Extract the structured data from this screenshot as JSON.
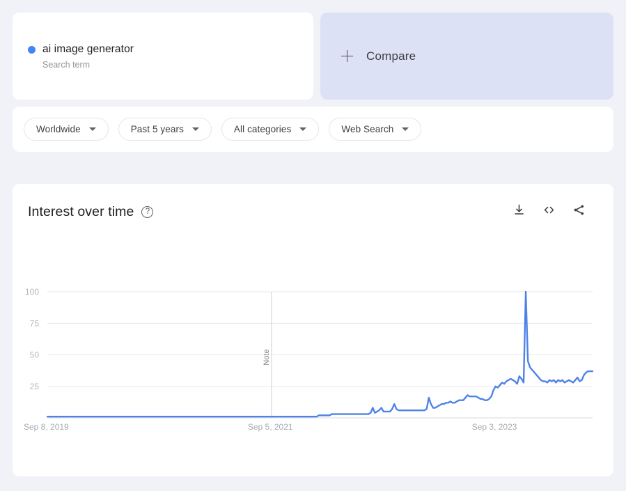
{
  "search_term_card": {
    "term": "ai image generator",
    "subtitle": "Search term",
    "dot_color": "#4285f4"
  },
  "compare_card": {
    "label": "Compare",
    "icon": "plus-icon",
    "background": "#dce1f6"
  },
  "filters": [
    {
      "label": "Worldwide"
    },
    {
      "label": "Past 5 years"
    },
    {
      "label": "All categories"
    },
    {
      "label": "Web Search"
    }
  ],
  "chart_panel": {
    "title": "Interest over time",
    "help_icon": "question-mark-icon",
    "actions": [
      {
        "name": "download-icon"
      },
      {
        "name": "embed-code-icon"
      },
      {
        "name": "share-icon"
      }
    ]
  },
  "chart_data": {
    "type": "line",
    "title": "Interest over time",
    "xlabel": "",
    "ylabel": "",
    "ylim": [
      0,
      100
    ],
    "yticks": [
      25,
      50,
      75,
      100
    ],
    "grid": true,
    "legend_position": "none",
    "line_color": "#4e82e8",
    "x_tick_labels": [
      "Sep 8, 2019",
      "Sep 5, 2021",
      "Sep 3, 2023"
    ],
    "x_tick_positions": [
      0,
      104,
      208
    ],
    "annotations": [
      {
        "label": "Note",
        "x_index": 104,
        "orientation": "vertical"
      }
    ],
    "series": [
      {
        "name": "ai image generator",
        "values": [
          1,
          1,
          1,
          1,
          1,
          1,
          1,
          1,
          1,
          1,
          1,
          1,
          1,
          1,
          1,
          1,
          1,
          1,
          1,
          1,
          1,
          1,
          1,
          1,
          1,
          1,
          1,
          1,
          1,
          1,
          1,
          1,
          1,
          1,
          1,
          1,
          1,
          1,
          1,
          1,
          1,
          1,
          1,
          1,
          1,
          1,
          1,
          1,
          1,
          1,
          1,
          1,
          1,
          1,
          1,
          1,
          1,
          1,
          1,
          1,
          1,
          1,
          1,
          1,
          1,
          1,
          1,
          1,
          1,
          1,
          1,
          1,
          1,
          1,
          1,
          1,
          1,
          1,
          1,
          1,
          1,
          1,
          1,
          1,
          1,
          1,
          1,
          1,
          1,
          1,
          1,
          1,
          1,
          1,
          1,
          1,
          1,
          1,
          1,
          1,
          1,
          1,
          1,
          1,
          1,
          1,
          1,
          1,
          1,
          1,
          1,
          1,
          1,
          1,
          1,
          1,
          1,
          1,
          1,
          1,
          1,
          1,
          1,
          1,
          1,
          1,
          2,
          2,
          2,
          2,
          2,
          2,
          3,
          3,
          3,
          3,
          3,
          3,
          3,
          3,
          3,
          3,
          3,
          3,
          3,
          3,
          3,
          3,
          3,
          3,
          4,
          8,
          4,
          5,
          6,
          8,
          5,
          5,
          5,
          5,
          7,
          11,
          7,
          6,
          6,
          6,
          6,
          6,
          6,
          6,
          6,
          6,
          6,
          6,
          6,
          6,
          7,
          16,
          11,
          8,
          8,
          9,
          10,
          11,
          11,
          12,
          12,
          13,
          12,
          12,
          13,
          14,
          14,
          14,
          16,
          18,
          17,
          17,
          17,
          17,
          16,
          15,
          15,
          14,
          14,
          15,
          17,
          22,
          25,
          24,
          26,
          28,
          27,
          29,
          30,
          31,
          30,
          29,
          27,
          33,
          31,
          28,
          100,
          45,
          40,
          38,
          36,
          34,
          32,
          30,
          29,
          29,
          28,
          30,
          29,
          30,
          28,
          30,
          29,
          30,
          28,
          29,
          30,
          29,
          28,
          30,
          32,
          29,
          30,
          34,
          36,
          37,
          37,
          37
        ]
      }
    ]
  }
}
